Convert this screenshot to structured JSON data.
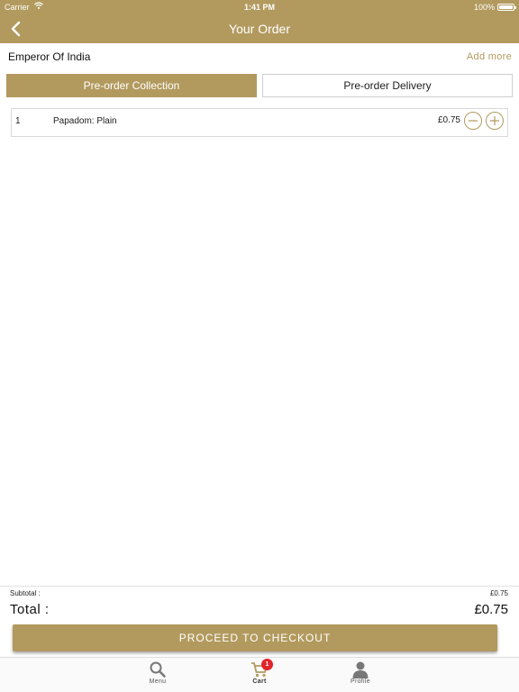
{
  "status_bar": {
    "carrier": "Carrier",
    "time": "1:41 PM",
    "battery": "100%"
  },
  "navbar": {
    "title": "Your Order",
    "back_icon": "chevron-left-icon"
  },
  "restaurant": {
    "name": "Emperor Of India",
    "add_more": "Add more"
  },
  "order_type_tabs": [
    {
      "label": "Pre-order Collection",
      "selected": true
    },
    {
      "label": "Pre-order Delivery",
      "selected": false
    }
  ],
  "order_items": [
    {
      "quantity": "1",
      "name": "Papadom: Plain",
      "price": "£0.75"
    }
  ],
  "totals": {
    "subtotal_label": "Subtotal :",
    "subtotal_value": "£0.75",
    "total_label": "Total :",
    "total_value": "£0.75"
  },
  "checkout_button": "PROCEED TO CHECKOUT",
  "tab_bar": {
    "items": [
      {
        "label": "Menu",
        "icon": "search-icon"
      },
      {
        "label": "Cart",
        "icon": "cart-icon",
        "badge": "1"
      },
      {
        "label": "Profile",
        "icon": "user-icon"
      }
    ]
  },
  "colors": {
    "accent": "#b29a5e",
    "badge": "#e2242b"
  }
}
